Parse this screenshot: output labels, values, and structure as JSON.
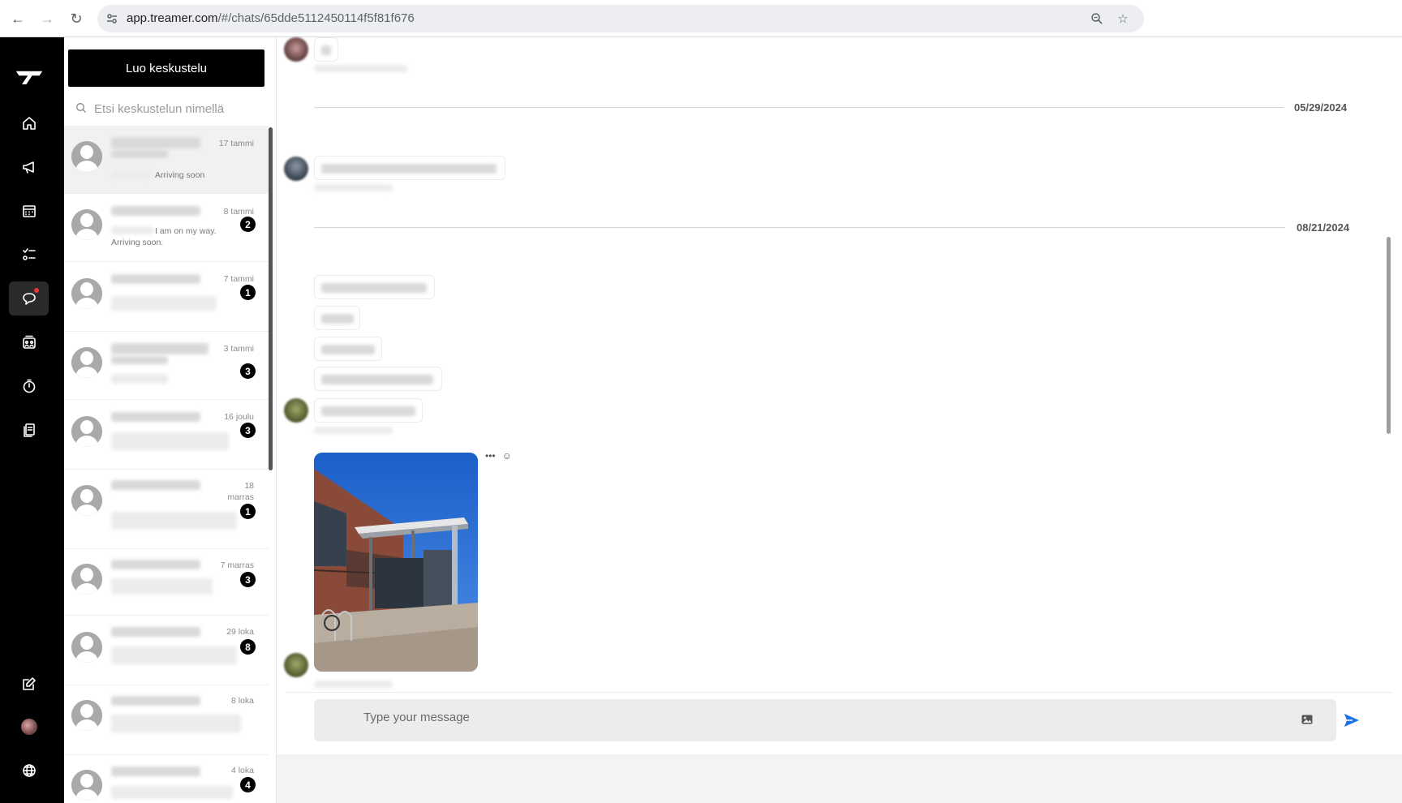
{
  "browser": {
    "url_host": "app.treamer.com",
    "url_path": "/#/chats/65dde5112450114f5f81f676"
  },
  "rail": {
    "items": [
      "home-icon",
      "megaphone-icon",
      "calendar-icon",
      "tasks-icon",
      "chat-icon",
      "team-icon",
      "timer-icon",
      "documents-icon",
      "edit-icon",
      "avatar",
      "globe-icon"
    ],
    "active": "chat-icon"
  },
  "list": {
    "new_chat_label": "Luo keskustelu",
    "search_placeholder": "Etsi keskustelun nimellä",
    "chats": [
      {
        "date": "17 tammi",
        "preview": "Arriving soon",
        "badge": ""
      },
      {
        "date": "8 tammi",
        "preview": "I am on my way. Arriving soon.",
        "badge": "2"
      },
      {
        "date": "7 tammi",
        "preview": "",
        "badge": "1"
      },
      {
        "date": "3 tammi",
        "preview": "",
        "badge": "3"
      },
      {
        "date": "16 joulu",
        "preview": "",
        "badge": "3"
      },
      {
        "date": "18 marras",
        "preview": "",
        "badge": "1"
      },
      {
        "date": "7 marras",
        "preview": "",
        "badge": "3"
      },
      {
        "date": "29 loka",
        "preview": "",
        "badge": "8"
      },
      {
        "date": "8 loka",
        "preview": "",
        "badge": ""
      },
      {
        "date": "4 loka",
        "preview": "",
        "badge": "4"
      }
    ]
  },
  "conversation": {
    "date_separators": [
      "05/29/2024",
      "08/21/2024"
    ],
    "photo_actions": [
      "•••",
      "☺"
    ],
    "composer_placeholder": "Type your message"
  },
  "colors": {
    "rail_bg": "#000000",
    "primary_button": "#000000",
    "badge": "#000000",
    "send_accent": "#1a73e8",
    "notification_dot": "#e53935"
  }
}
